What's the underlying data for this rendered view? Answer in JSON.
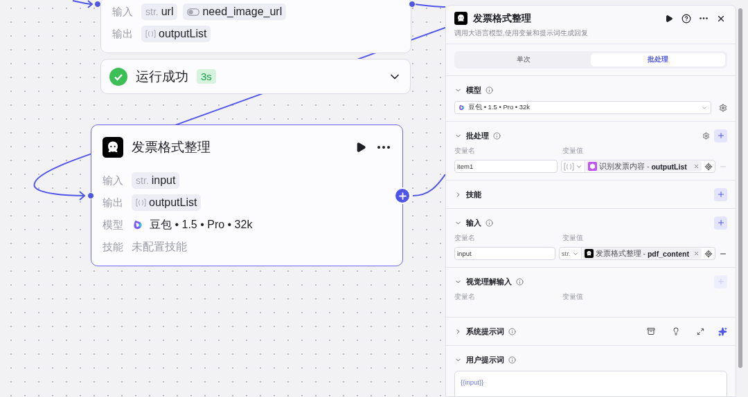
{
  "canvas": {
    "top_node": {
      "rows": [
        {
          "label": "输入",
          "tags": [
            {
              "kind": "str",
              "prefix": "str.",
              "name": "url"
            },
            {
              "kind": "toggle",
              "name": "need_image_url"
            }
          ]
        },
        {
          "label": "输出",
          "tags": [
            {
              "kind": "list",
              "name": "outputList"
            }
          ]
        }
      ]
    },
    "run_status": {
      "kind": "success",
      "label": "运行成功",
      "duration": "3s"
    },
    "node": {
      "title": "发票格式整理",
      "rows": [
        {
          "kind": "tags",
          "label": "输入",
          "tags": [
            {
              "kind": "str",
              "prefix": "str.",
              "name": "input"
            }
          ]
        },
        {
          "kind": "tags",
          "label": "输出",
          "tags": [
            {
              "kind": "list",
              "name": "outputList"
            }
          ]
        },
        {
          "kind": "model",
          "label": "模型",
          "value": "豆包 • 1.5 • Pro • 32k"
        },
        {
          "kind": "text",
          "label": "技能",
          "value": "未配置技能"
        }
      ]
    }
  },
  "panel": {
    "title": "发票格式整理",
    "description": "调用大语言模型,使用变量和提示词生成回复",
    "tabs": [
      {
        "label": "单次",
        "selected": false
      },
      {
        "label": "批处理",
        "selected": true
      }
    ],
    "sections": [
      {
        "kind": "model",
        "title": "模型",
        "expanded": true,
        "model": "豆包 • 1.5 • Pro • 32k"
      },
      {
        "kind": "vars",
        "title": "批处理",
        "expanded": true,
        "settings": true,
        "add_disabled": false,
        "columns": [
          "变量名",
          "变量值"
        ],
        "rows": [
          {
            "name": "item1",
            "type": {
              "kind": "list"
            },
            "source": {
              "kind": "cube",
              "node": "识别发票内容 -",
              "field": "outputList"
            },
            "remove_disabled": true
          }
        ]
      },
      {
        "kind": "plain",
        "title": "技能",
        "expanded": false,
        "add_disabled": false
      },
      {
        "kind": "vars",
        "title": "输入",
        "expanded": true,
        "add_disabled": false,
        "columns": [
          "变量名",
          "变量值"
        ],
        "rows": [
          {
            "name": "input",
            "type": {
              "kind": "str",
              "label": "str."
            },
            "source": {
              "kind": "bot",
              "node": "发票格式整理 -",
              "field": "pdf_content"
            },
            "remove_disabled": false
          }
        ]
      },
      {
        "kind": "vars",
        "title": "视觉理解输入",
        "expanded": true,
        "add_disabled": true,
        "columns": [
          "变量名",
          "变量值"
        ]
      },
      {
        "kind": "tools",
        "title": "系统提示词",
        "expanded": false
      },
      {
        "kind": "prompt",
        "title": "用户提示词",
        "expanded": true,
        "value": "{{input}}"
      }
    ]
  }
}
